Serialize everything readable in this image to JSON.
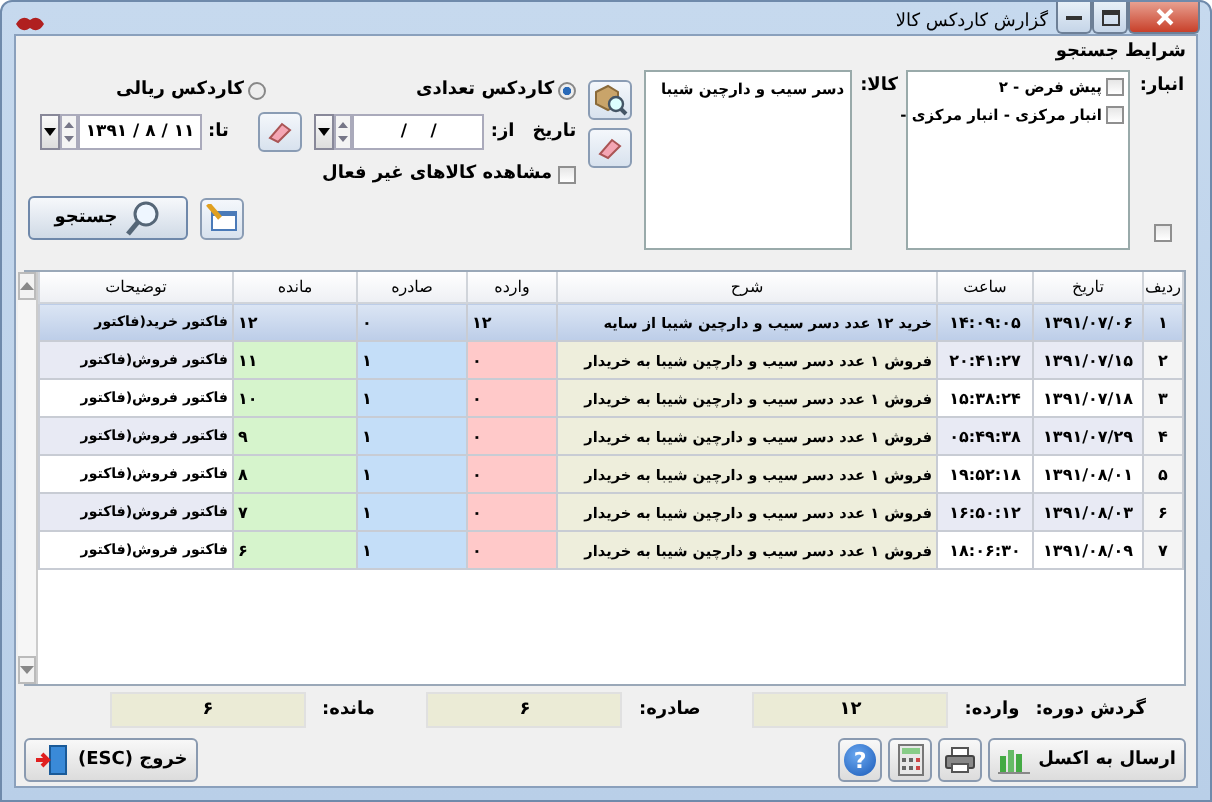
{
  "window": {
    "title": "گزارش کاردکس کالا"
  },
  "search": {
    "title": "شرایط جستجو",
    "warehouse_label": "انبار:",
    "warehouses": [
      {
        "label": "پیش فرض - ۲",
        "checked": false
      },
      {
        "label": "انبار مرکزی - انبار مرکزی -",
        "checked": false
      }
    ],
    "select_all_checked": false,
    "item_label": "کالا:",
    "items": [
      "دسر سیب و دارچین شیبا"
    ],
    "kardex_types": [
      {
        "label": "کاردکس تعدادی",
        "selected": true
      },
      {
        "label": "کاردکس ریالی",
        "selected": false
      }
    ],
    "date_label": "تاریخ",
    "from_label": "از:",
    "from_value": "/    /",
    "to_label": "تا:",
    "to_value": "۱۳۹۱ / ۸ / ۱۱",
    "show_inactive": {
      "label": "مشاهده کالاهای غیر فعال",
      "checked": false
    },
    "search_button": "جستجو"
  },
  "table": {
    "columns": [
      "ردیف",
      "تاریخ",
      "ساعت",
      "شرح",
      "وارده",
      "صادره",
      "مانده",
      "توضیحات"
    ],
    "rows": [
      {
        "selected": true,
        "cells": [
          "۱",
          "۱۳۹۱/۰۷/۰۶",
          "۱۴:۰۹:۰۵",
          "خرید ۱۲ عدد دسر سیب و دارچین شیبا  از  سایه",
          "۱۲",
          "۰",
          "۱۲",
          "فاکتور خرید(فاکتور"
        ]
      },
      {
        "selected": false,
        "cells": [
          "۲",
          "۱۳۹۱/۰۷/۱۵",
          "۲۰:۴۱:۲۷",
          "فروش ۱ عدد دسر سیب و دارچین شیبا  به  خریدار",
          "۰",
          "۱",
          "۱۱",
          "فاکتور فروش(فاکتور"
        ]
      },
      {
        "selected": false,
        "cells": [
          "۳",
          "۱۳۹۱/۰۷/۱۸",
          "۱۵:۳۸:۲۴",
          "فروش ۱ عدد دسر سیب و دارچین شیبا  به  خریدار",
          "۰",
          "۱",
          "۱۰",
          "فاکتور فروش(فاکتور"
        ]
      },
      {
        "selected": false,
        "cells": [
          "۴",
          "۱۳۹۱/۰۷/۲۹",
          "۰۵:۴۹:۳۸",
          "فروش ۱ عدد دسر سیب و دارچین شیبا  به  خریدار",
          "۰",
          "۱",
          "۹",
          "فاکتور فروش(فاکتور"
        ]
      },
      {
        "selected": false,
        "cells": [
          "۵",
          "۱۳۹۱/۰۸/۰۱",
          "۱۹:۵۲:۱۸",
          "فروش ۱ عدد دسر سیب و دارچین شیبا  به  خریدار",
          "۰",
          "۱",
          "۸",
          "فاکتور فروش(فاکتور"
        ]
      },
      {
        "selected": false,
        "cells": [
          "۶",
          "۱۳۹۱/۰۸/۰۳",
          "۱۶:۵۰:۱۲",
          "فروش ۱ عدد دسر سیب و دارچین شیبا  به  خریدار",
          "۰",
          "۱",
          "۷",
          "فاکتور فروش(فاکتور"
        ]
      },
      {
        "selected": false,
        "cells": [
          "۷",
          "۱۳۹۱/۰۸/۰۹",
          "۱۸:۰۶:۳۰",
          "فروش ۱ عدد دسر سیب و دارچین شیبا  به  خریدار",
          "۰",
          "۱",
          "۶",
          "فاکتور فروش(فاکتور"
        ]
      }
    ]
  },
  "totals": {
    "title": "گردش دوره:",
    "incoming_label": "وارده:",
    "incoming": "۱۲",
    "outgoing_label": "صادره:",
    "outgoing": "۶",
    "balance_label": "مانده:",
    "balance": "۶"
  },
  "buttons": {
    "excel": "ارسال به اکسل",
    "help": "?",
    "exit": "خروج (ESC)"
  }
}
